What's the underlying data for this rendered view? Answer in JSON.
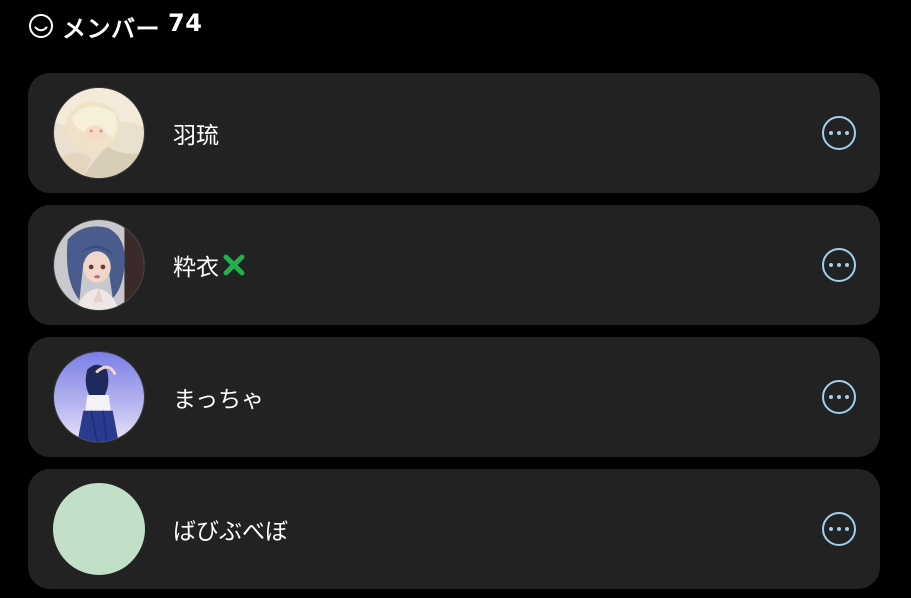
{
  "header": {
    "icon": "smiley-icon",
    "title": "メンバー",
    "count": "74"
  },
  "members": [
    {
      "name": "羽琉",
      "avatar": "avatar-illustration-blonde",
      "badge": null,
      "more_icon": "more-options-icon"
    },
    {
      "name": "粋衣",
      "avatar": "avatar-illustration-blue-hair",
      "badge": "green-cross-icon",
      "more_icon": "more-options-icon"
    },
    {
      "name": "まっちゃ",
      "avatar": "avatar-illustration-girl-window",
      "badge": null,
      "more_icon": "more-options-icon"
    },
    {
      "name": "ばびぶべぼ",
      "avatar": "avatar-plain-mint",
      "badge": null,
      "more_icon": "more-options-icon"
    }
  ],
  "colors": {
    "background": "#000000",
    "card": "#222222",
    "accent": "#9fd1ef",
    "badge_green": "#22b14c",
    "mint_avatar": "#c2dfc7"
  }
}
